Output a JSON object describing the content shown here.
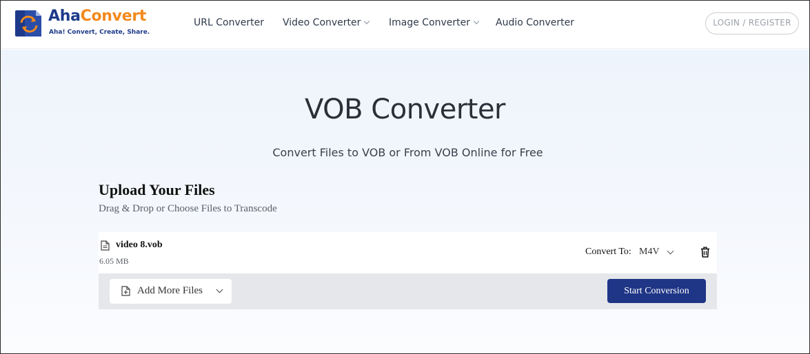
{
  "header": {
    "logo": {
      "name_part1": "Aha",
      "name_part2": "Convert",
      "tagline": "Aha! Convert, Create, Share."
    },
    "nav": [
      {
        "label": "URL Converter",
        "has_dropdown": false
      },
      {
        "label": "Video Converter",
        "has_dropdown": true
      },
      {
        "label": "Image Converter",
        "has_dropdown": true
      },
      {
        "label": "Audio Converter",
        "has_dropdown": false
      }
    ],
    "login_label": "LOGIN / REGISTER"
  },
  "hero": {
    "title": "VOB Converter",
    "subtitle": "Convert Files to VOB or From VOB Online for Free"
  },
  "upload": {
    "title": "Upload Your Files",
    "subtitle": "Drag & Drop or Choose Files to Transcode"
  },
  "files": [
    {
      "name": "video 8.vob",
      "size": "6.05 MB",
      "convert_label": "Convert To:",
      "format": "M4V",
      "icons": [
        "file-icon",
        "chevron-down-icon",
        "trash-icon"
      ]
    }
  ],
  "actions": {
    "add_more_label": "Add More Files",
    "start_label": "Start Conversion"
  },
  "colors": {
    "brand_blue": "#1d3a8a",
    "brand_orange": "#f28a1e",
    "primary_button": "#1f3586",
    "hero_bg": "#eef4fc"
  }
}
